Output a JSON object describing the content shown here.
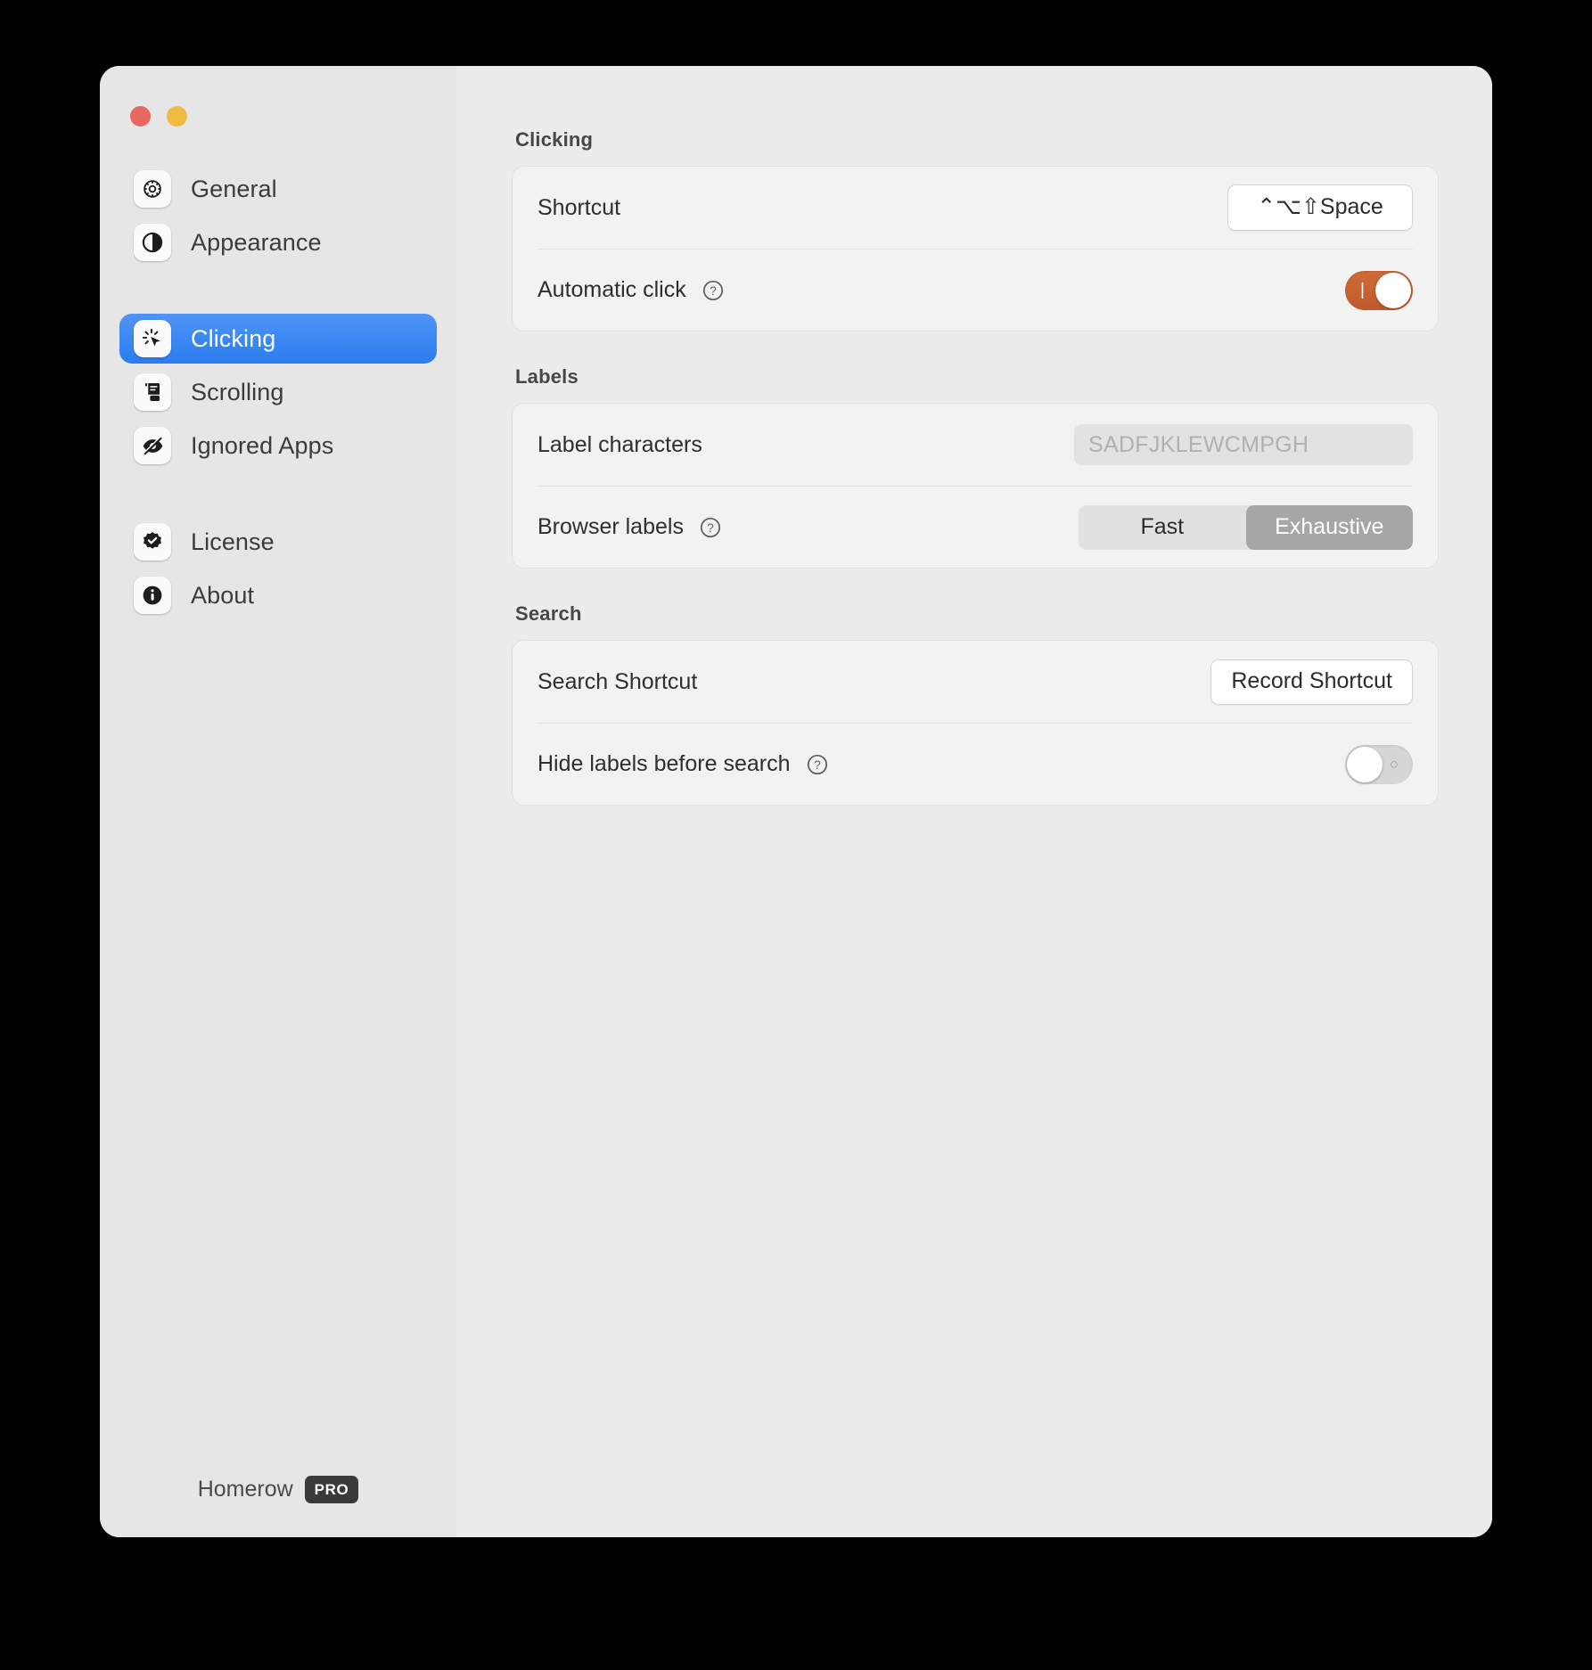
{
  "window": {
    "traffic_lights": [
      {
        "name": "close",
        "color": "#e8685f"
      },
      {
        "name": "minimize",
        "color": "#f0bb41"
      }
    ]
  },
  "sidebar": {
    "groups": [
      {
        "items": [
          {
            "label": "General",
            "icon": "gear-icon",
            "active": false
          },
          {
            "label": "Appearance",
            "icon": "contrast-circle-icon",
            "active": false
          }
        ]
      },
      {
        "items": [
          {
            "label": "Clicking",
            "icon": "click-cursor-icon",
            "active": true
          },
          {
            "label": "Scrolling",
            "icon": "scroll-document-icon",
            "active": false
          },
          {
            "label": "Ignored Apps",
            "icon": "eye-slash-icon",
            "active": false
          }
        ]
      },
      {
        "items": [
          {
            "label": "License",
            "icon": "seal-check-icon",
            "active": false
          },
          {
            "label": "About",
            "icon": "info-circle-icon",
            "active": false
          }
        ]
      }
    ],
    "footer": {
      "name": "Homerow",
      "badge": "PRO"
    }
  },
  "main": {
    "sections": [
      {
        "title": "Clicking",
        "rows": [
          {
            "label": "Shortcut",
            "help": false,
            "control": "shortcut-button",
            "value": "⌃⌥⇧Space"
          },
          {
            "label": "Automatic click",
            "help": true,
            "control": "toggle",
            "state": "on",
            "mark": "|",
            "accent": "#c4612f"
          }
        ]
      },
      {
        "title": "Labels",
        "rows": [
          {
            "label": "Label characters",
            "help": false,
            "control": "text-field",
            "value": "",
            "placeholder": "SADFJKLEWCMPGH"
          },
          {
            "label": "Browser labels",
            "help": true,
            "control": "segmented",
            "options": [
              "Fast",
              "Exhaustive"
            ],
            "selected": "Exhaustive"
          }
        ]
      },
      {
        "title": "Search",
        "rows": [
          {
            "label": "Search Shortcut",
            "help": false,
            "control": "record-button",
            "value": "Record Shortcut"
          },
          {
            "label": "Hide labels before search",
            "help": true,
            "control": "toggle",
            "state": "off",
            "mark": "○"
          }
        ]
      }
    ]
  },
  "colors": {
    "accent_selected": "#2b7cf0",
    "toggle_on": "#c4612f",
    "window_bg": "#ececec",
    "sidebar_bg": "#e6e6e6"
  }
}
